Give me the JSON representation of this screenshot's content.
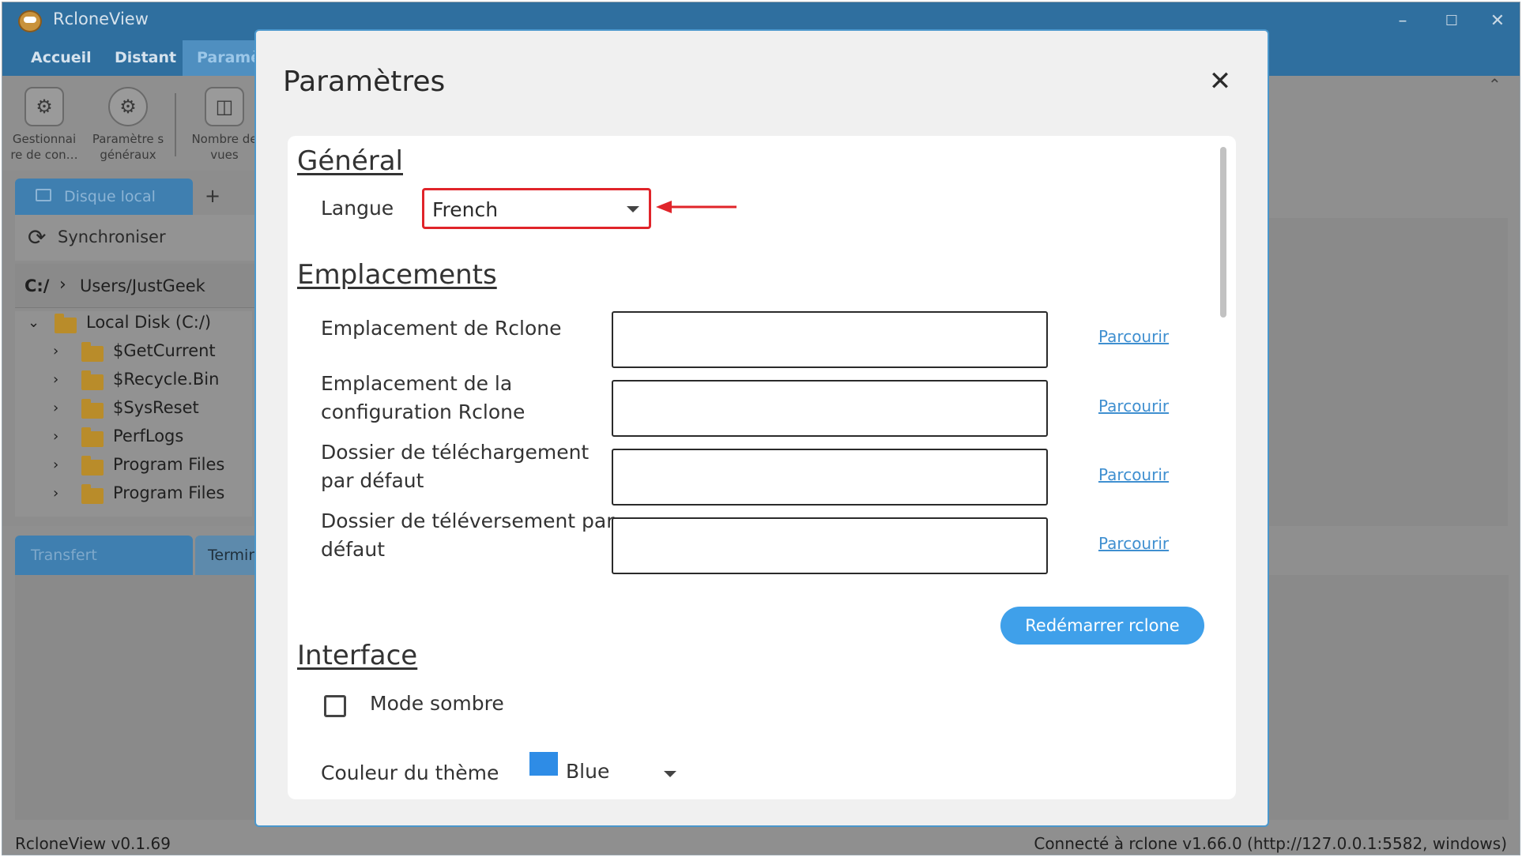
{
  "app": {
    "title": "RcloneView",
    "version": "RcloneView v0.1.69",
    "connection_status": "Connecté à rclone v1.66.0 (http://127.0.0.1:5582, windows)"
  },
  "window_controls": {
    "minimize": "–",
    "maximize": "☐",
    "close": "✕"
  },
  "menu": {
    "tabs": [
      {
        "label": "Accueil"
      },
      {
        "label": "Distant"
      },
      {
        "label": "Paramè"
      }
    ]
  },
  "ribbon": {
    "buttons": [
      {
        "label": "Gestionnai re de con…",
        "icon": "connection-manager-icon"
      },
      {
        "label": "Paramètre s généraux",
        "icon": "gear-icon"
      },
      {
        "label": "Nombre de vues",
        "icon": "split-view-icon"
      }
    ],
    "collapse": "⌃"
  },
  "explorer": {
    "tab_label": "Disque local",
    "add_tab": "+",
    "sync_label": "Synchroniser",
    "path_root": "C:/",
    "path_chevron": "›",
    "path": "Users/JustGeek",
    "tree": [
      {
        "label": "Local Disk (C:/)",
        "toggle": "⌄",
        "level": 0
      },
      {
        "label": "$GetCurrent",
        "toggle": "›",
        "level": 1
      },
      {
        "label": "$Recycle.Bin",
        "toggle": "›",
        "level": 1
      },
      {
        "label": "$SysReset",
        "toggle": "›",
        "level": 1
      },
      {
        "label": "PerfLogs",
        "toggle": "›",
        "level": 1
      },
      {
        "label": "Program Files",
        "toggle": "›",
        "level": 1
      },
      {
        "label": "Program Files",
        "toggle": "›",
        "level": 1
      }
    ]
  },
  "bottom_tabs": {
    "transfer": "Transfert",
    "done": "Termin"
  },
  "dialog": {
    "title": "Paramètres",
    "close": "✕",
    "general": {
      "heading": "Général",
      "language_label": "Langue",
      "language_value": "French"
    },
    "locations": {
      "heading": "Emplacements",
      "browse_label": "Parcourir",
      "fields": [
        {
          "label_line1": "Emplacement de Rclone",
          "label_line2": "",
          "value": ""
        },
        {
          "label_line1": "Emplacement de la",
          "label_line2": "configuration Rclone",
          "value": ""
        },
        {
          "label_line1": "Dossier de téléchargement",
          "label_line2": "par défaut",
          "value": ""
        },
        {
          "label_line1": "Dossier de téléversement par",
          "label_line2": "défaut",
          "value": ""
        }
      ],
      "restart_button": "Redémarrer rclone"
    },
    "interface": {
      "heading": "Interface",
      "dark_mode_label": "Mode sombre",
      "dark_mode_checked": false,
      "theme_color_label": "Couleur du thème",
      "theme_color_value": "Blue",
      "theme_color_swatch": "#2e8ce6"
    }
  },
  "annotation": {
    "arrow_color": "#e0242a"
  }
}
